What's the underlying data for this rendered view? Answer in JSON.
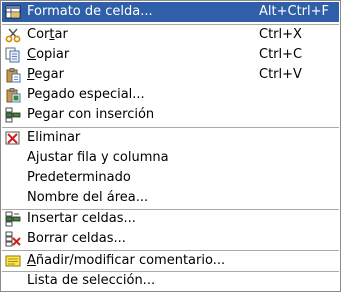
{
  "colors": {
    "highlight": "#2f5fa8",
    "border": "#8a8a8a",
    "separator": "#a9a9a9"
  },
  "menu": {
    "items": [
      {
        "label": "Formato de celda...",
        "shortcut": "Alt+Ctrl+F",
        "icon": "format-cells-icon",
        "highlighted": true
      },
      {
        "label_pre": "Cor",
        "label_acc": "t",
        "label_post": "ar",
        "shortcut": "Ctrl+X",
        "icon": "scissors-icon"
      },
      {
        "label_pre": "",
        "label_acc": "C",
        "label_post": "opiar",
        "shortcut": "Ctrl+C",
        "icon": "copy-icon"
      },
      {
        "label_pre": "",
        "label_acc": "P",
        "label_post": "egar",
        "shortcut": "Ctrl+V",
        "icon": "paste-icon"
      },
      {
        "label": "Pegado especial...",
        "icon": "paste-special-icon"
      },
      {
        "label": "Pegar con inserción",
        "icon": "paste-insert-icon"
      },
      {
        "label": "Eliminar",
        "icon": "delete-icon"
      },
      {
        "label": "Ajustar fila y columna"
      },
      {
        "label": "Predeterminado"
      },
      {
        "label": "Nombre del área..."
      },
      {
        "label": "Insertar celdas...",
        "icon": "insert-cells-icon"
      },
      {
        "label": "Borrar celdas...",
        "icon": "delete-cells-icon"
      },
      {
        "label_pre": "",
        "label_acc": "A",
        "label_post": "ñadir/modificar comentario...",
        "icon": "comment-icon"
      },
      {
        "label": "Lista de selección..."
      }
    ]
  }
}
